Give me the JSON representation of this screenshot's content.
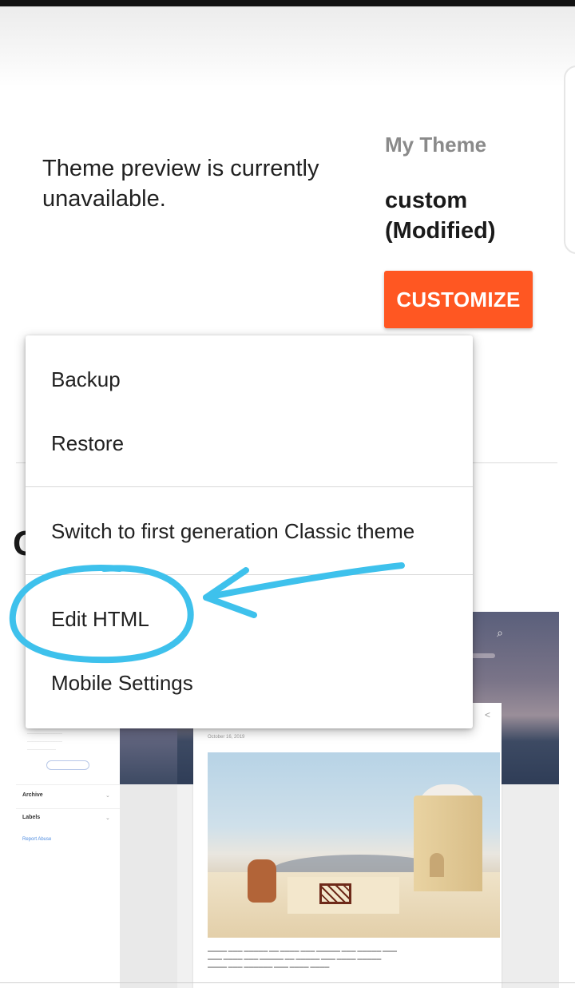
{
  "theme_panel": {
    "preview_message": "Theme preview is currently unavailable.",
    "my_theme_label": "My Theme",
    "theme_name": "custom (Modified)",
    "customize_label": "CUSTOMIZE",
    "section_heading_partial": "C"
  },
  "menu": {
    "items": [
      {
        "label": "Backup"
      },
      {
        "label": "Restore"
      },
      {
        "label": "Switch to first generation Classic theme"
      },
      {
        "label": "Edit HTML"
      },
      {
        "label": "Mobile Settings"
      }
    ]
  },
  "thumbnail": {
    "sidebar_rows": [
      "Archive",
      "Labels"
    ],
    "sidebar_link": "Report Abuse",
    "post_date": "October 16, 2019"
  },
  "annotation": {
    "highlight_target": "Edit HTML",
    "color": "#3ec1ec"
  },
  "colors": {
    "accent": "#ff5722",
    "annotation": "#3ec1ec"
  }
}
